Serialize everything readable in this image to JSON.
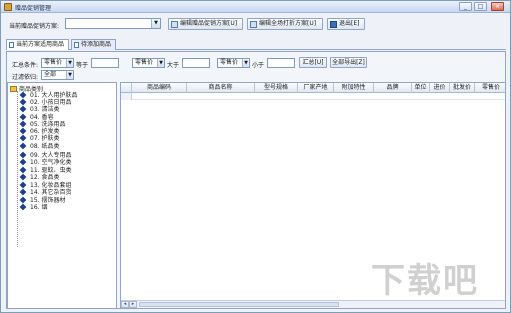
{
  "window": {
    "title": "赠品促销管理"
  },
  "toolbar": {
    "scheme_label": "当前赠品促销方案:",
    "scheme_value": "",
    "edit_button": "编辑赠品促销方案[U]",
    "all_button": "编辑全场打折方案[U]",
    "exit_button": "退出[E]"
  },
  "tabs": [
    {
      "label": "当前方案适用商品"
    },
    {
      "label": "待添加商品"
    }
  ],
  "filter": {
    "summary_label": "汇总条件:",
    "field1_value": "零售价",
    "op1_label": "等于",
    "field2_value": "零售价",
    "op2_label": "大于",
    "field3_value": "零售价",
    "op3_label": "小于",
    "summary_button": "汇总[U]",
    "export_button": "全部导出[Z]",
    "filter_label": "过滤依归:",
    "filter_value": "全部"
  },
  "tree": {
    "root": "商品类别",
    "items": [
      "01. 大人用护肤品",
      "02. 小孩日用品",
      "03. 清洁类",
      "04. 香皂",
      "05. 洗涤用品",
      "06. 护发类",
      "07. 护肤类",
      "08. 纸品类",
      "09. 大人专用品",
      "10. 空气净化类",
      "11. 驱蚊、虫类",
      "12. 食品类",
      "13. 化妆品套组",
      "14. 其它杂百货",
      "15. 摆饰器材",
      "16. 烟"
    ]
  },
  "grid": {
    "columns": [
      "商品编码",
      "商品名称",
      "型号规格",
      "厂家产地",
      "附加特性",
      "品牌",
      "单位",
      "进价",
      "批发价",
      "零售价"
    ]
  },
  "watermark": "下载吧"
}
